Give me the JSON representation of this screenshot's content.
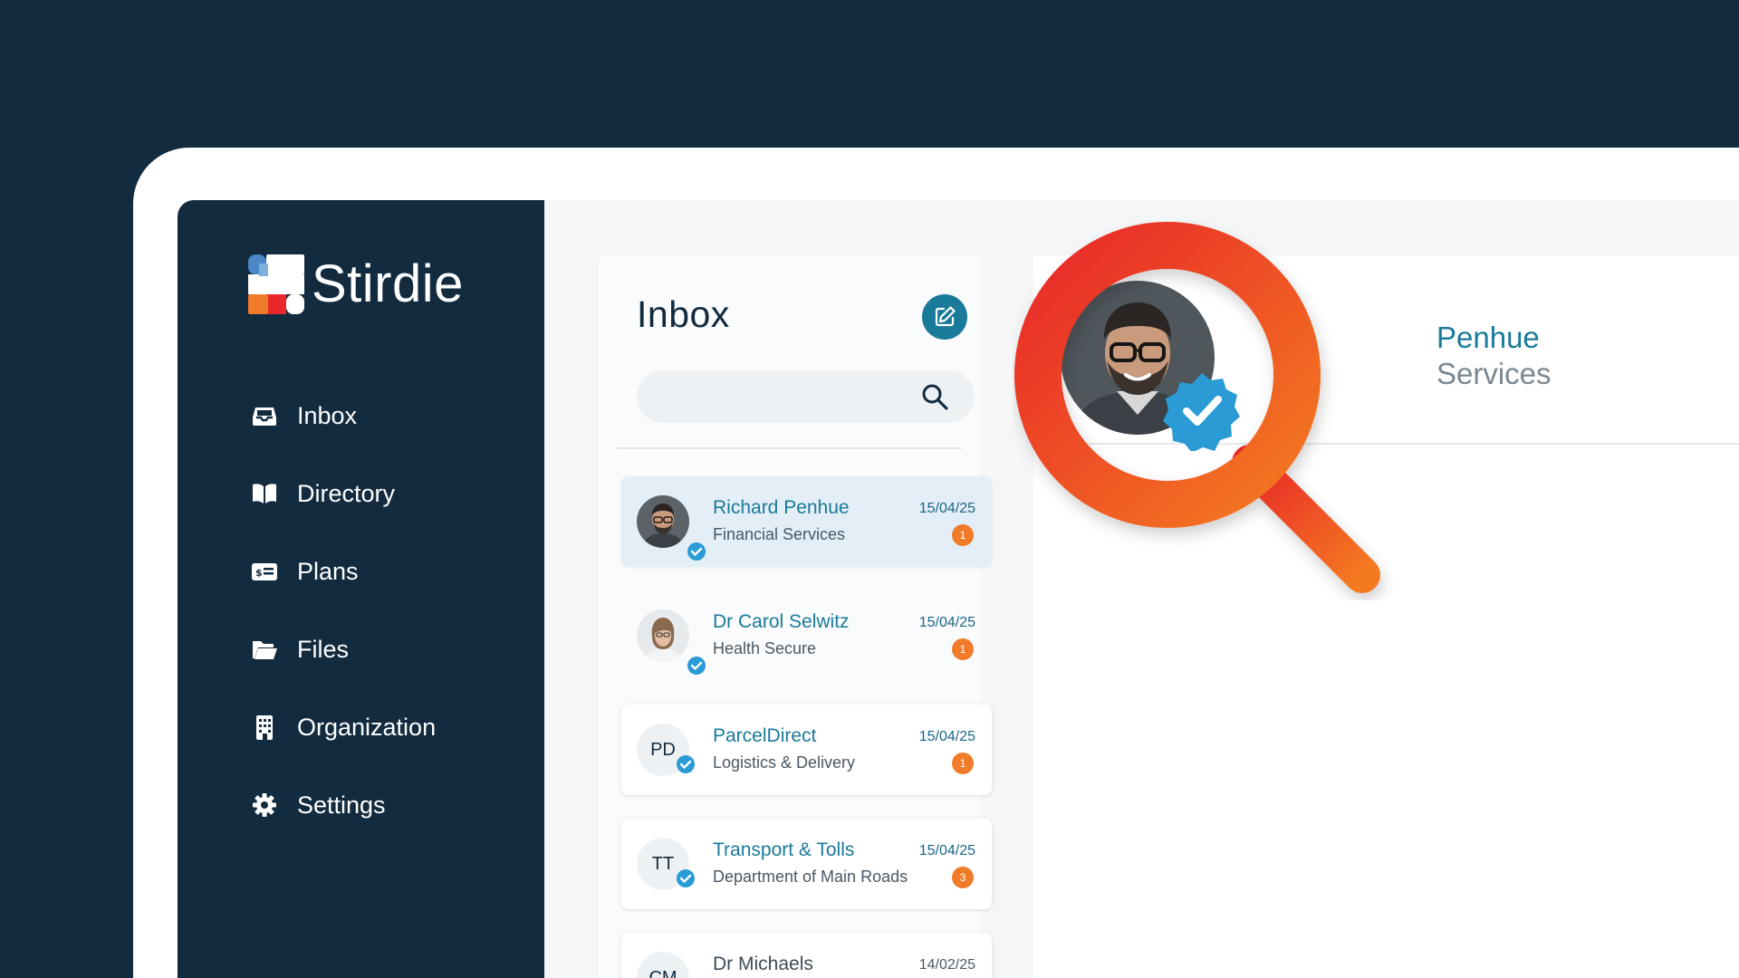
{
  "app": {
    "name": "Stirdie"
  },
  "sidebar": {
    "items": [
      {
        "label": "Inbox",
        "icon": "inbox-icon"
      },
      {
        "label": "Directory",
        "icon": "book-icon"
      },
      {
        "label": "Plans",
        "icon": "plan-card-icon"
      },
      {
        "label": "Files",
        "icon": "folder-icon"
      },
      {
        "label": "Organization",
        "icon": "building-icon"
      },
      {
        "label": "Settings",
        "icon": "gear-icon"
      }
    ]
  },
  "inbox": {
    "title": "Inbox",
    "search_placeholder": "",
    "conversations": [
      {
        "name": "Richard Penhue",
        "subtitle": "Financial Services",
        "date": "15/04/25",
        "unread": "1",
        "verified": true,
        "active": true
      },
      {
        "name": "Dr Carol Selwitz",
        "subtitle": "Health Secure",
        "date": "15/04/25",
        "unread": "1",
        "verified": true
      },
      {
        "name": "ParcelDirect",
        "subtitle": "Logistics & Delivery",
        "date": "15/04/25",
        "unread": "1",
        "initials": "PD",
        "verified": true
      },
      {
        "name": "Transport & Tolls",
        "subtitle": "Department of Main Roads",
        "date": "15/04/25",
        "unread": "3",
        "initials": "TT",
        "verified": true
      },
      {
        "name": "Dr Michaels",
        "subtitle": "",
        "date": "14/02/25",
        "initials": "CM"
      }
    ]
  },
  "detail": {
    "name_visible": "Penhue",
    "subtitle_visible": "Services"
  },
  "colors": {
    "navy": "#132b3f",
    "accent": "#1a7a9a",
    "unread": "#f07c2a",
    "verified": "#2b9bd6",
    "magnifier_start": "#e8282a",
    "magnifier_end": "#f47a20"
  }
}
